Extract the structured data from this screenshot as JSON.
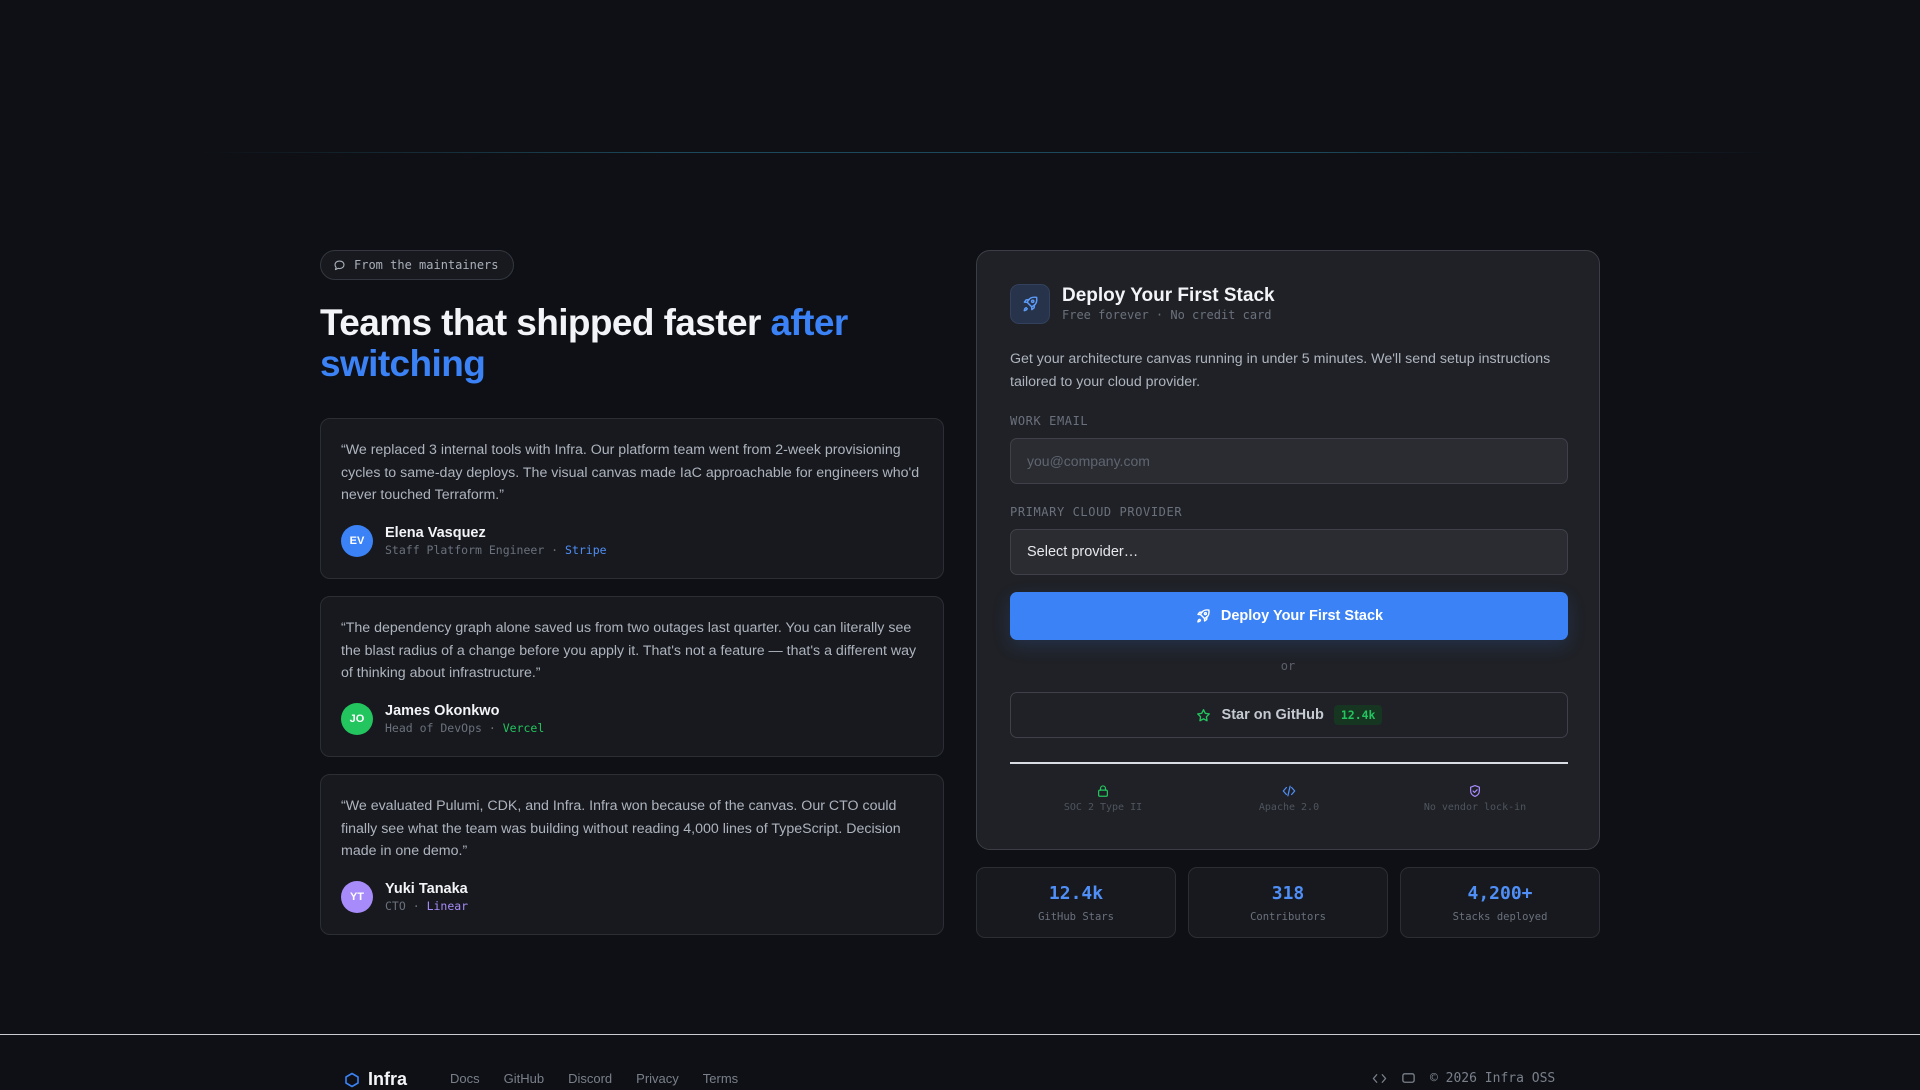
{
  "badge": {
    "label": "From the maintainers",
    "icon": "chat-bubble-icon"
  },
  "headline": {
    "text": "Teams that shipped faster ",
    "accent": "after switching"
  },
  "testimonials": [
    {
      "quote": "“We replaced 3 internal tools with Infra. Our platform team went from 2-week provisioning cycles to same-day deploys. The visual canvas made IaC approachable for engineers who'd never touched Terraform.”",
      "initials": "EV",
      "avatar_color": "#3b82f6",
      "name": "Elena Vasquez",
      "role": "Staff Platform Engineer",
      "company": "Stripe",
      "company_color": "#4f8ff7"
    },
    {
      "quote": "“The dependency graph alone saved us from two outages last quarter. You can literally see the blast radius of a change before you apply it. That's not a feature — that's a different way of thinking about infrastructure.”",
      "initials": "JO",
      "avatar_color": "#22c55e",
      "name": "James Okonkwo",
      "role": "Head of DevOps",
      "company": "Vercel",
      "company_color": "#22c55e"
    },
    {
      "quote": "“We evaluated Pulumi, CDK, and Infra. Infra won because of the canvas. Our CTO could finally see what the team was building without reading 4,000 lines of TypeScript. Decision made in one demo.”",
      "initials": "YT",
      "avatar_color": "#a78bfa",
      "name": "Yuki Tanaka",
      "role": "CTO",
      "company": "Linear",
      "company_color": "#a78bfa"
    }
  ],
  "signup": {
    "icon": "rocket-icon",
    "title": "Deploy Your First Stack",
    "subtitle": "Free forever · No credit card",
    "description": "Get your architecture canvas running in under 5 minutes. We'll send setup instructions tailored to your cloud provider.",
    "email_label": "WORK EMAIL",
    "email_placeholder": "you@company.com",
    "provider_label": "PRIMARY CLOUD PROVIDER",
    "provider_value": "Select provider…",
    "cta_label": "Deploy Your First Stack",
    "or_label": "or",
    "github_label": "Star on GitHub",
    "github_count": "12.4k",
    "trust": [
      {
        "label": "SOC 2 Type II",
        "icon": "lock-icon",
        "color": "#22c55e"
      },
      {
        "label": "Apache 2.0",
        "icon": "code-icon",
        "color": "#4f8ff7"
      },
      {
        "label": "No vendor lock-in",
        "icon": "shield-check-icon",
        "color": "#a78bfa"
      }
    ]
  },
  "stats": [
    {
      "value": "12.4k",
      "label": "GitHub Stars"
    },
    {
      "value": "318",
      "label": "Contributors"
    },
    {
      "value": "4,200+",
      "label": "Stacks deployed"
    }
  ],
  "footer": {
    "brand": "Infra",
    "links": [
      "Docs",
      "GitHub",
      "Discord",
      "Privacy",
      "Terms"
    ],
    "copyright": "© 2026 Infra OSS"
  },
  "colors": {
    "accent": "#3b82f6",
    "background": "#0e1015",
    "panel": "#1f2126",
    "success": "#22c55e"
  }
}
